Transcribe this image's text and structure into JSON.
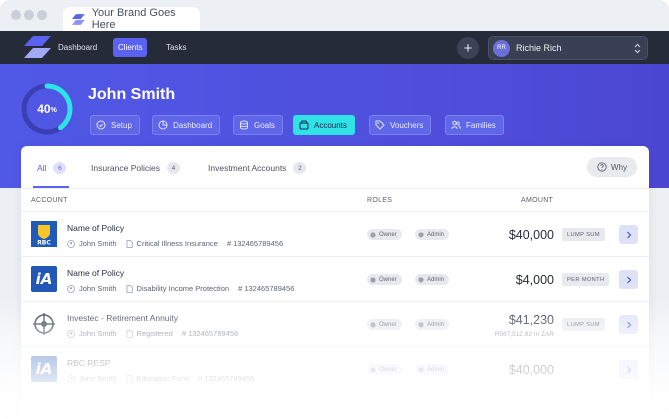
{
  "browser": {
    "tab_title": "Your Brand Goes Here"
  },
  "nav": {
    "links": [
      "Dashboard",
      "Clients",
      "Tasks"
    ],
    "active": "Clients",
    "add_label": "+",
    "user": {
      "initials": "RR",
      "name": "Richie Rich"
    }
  },
  "client": {
    "progress_value": "40",
    "progress_unit": "%",
    "progress_fraction": 0.4,
    "name": "John Smith",
    "tabs": [
      "Setup",
      "Dashboard",
      "Goals",
      "Accounts",
      "Vouchers",
      "Families"
    ],
    "active_tab": "Accounts"
  },
  "filters": [
    {
      "label": "All",
      "count": "6"
    },
    {
      "label": "Insurance Policies",
      "count": "4"
    },
    {
      "label": "Investment Accounts",
      "count": "2"
    }
  ],
  "why_label": "Why",
  "columns": {
    "account": "ACCOUNT",
    "roles": "ROLES",
    "amount": "AMOUNT"
  },
  "accounts": [
    {
      "logo": "RBC",
      "title": "Name of Policy",
      "owner": "John Smith",
      "category": "Critical Illness Insurance",
      "number": "# 132465789456",
      "roles": [
        "Owner",
        "Admin"
      ],
      "amount": "$40,000",
      "amount_sub": "",
      "frequency": "LUMP SUM"
    },
    {
      "logo": "iA",
      "title": "Name of Policy",
      "owner": "John Smith",
      "category": "Disability Income Protection",
      "number": "# 132465789456",
      "roles": [
        "Owner",
        "Admin"
      ],
      "amount": "$4,000",
      "amount_sub": "",
      "frequency": "PER MONTH"
    },
    {
      "logo": "investec",
      "title": "Investec - Retirement Annuity",
      "owner": "John Smith",
      "category": "Registered",
      "number": "# 132465789456",
      "roles": [
        "Owner",
        "Admin"
      ],
      "amount": "$41,230",
      "amount_sub": "R567,512.82 In ZAR",
      "frequency": "LUMP SUM"
    },
    {
      "logo": "iA",
      "title": "RBC RESP",
      "owner": "John Smith",
      "category": "Education Fund",
      "number": "# 132465789456",
      "roles": [
        "Owner",
        "Admin"
      ],
      "amount": "$40,000",
      "amount_sub": "",
      "frequency": ""
    }
  ],
  "colors": {
    "accent": "#5b62f0",
    "hero": "#4f4fdc",
    "active_tab": "#2ee2e6",
    "nav_bg": "#262b3a"
  }
}
